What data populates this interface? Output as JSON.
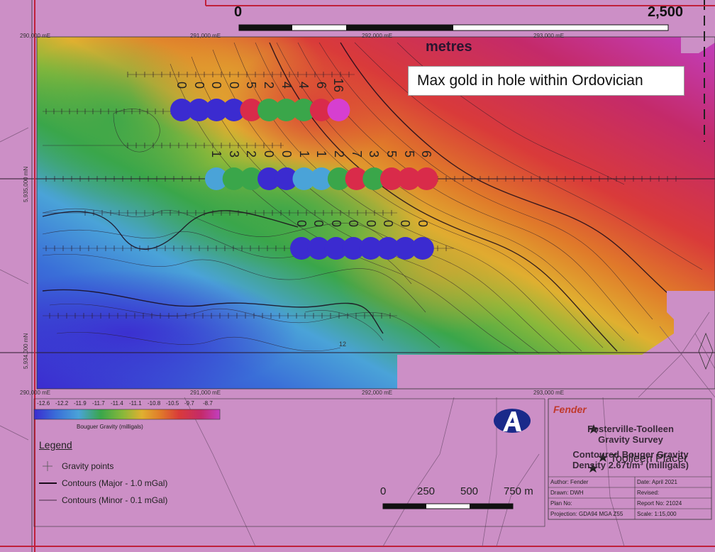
{
  "scale_top": {
    "start": "0",
    "end": "2,500",
    "unit": "metres"
  },
  "callout": "Max gold in hole within Ordovician",
  "coords": {
    "east_top": [
      "290,000 mE",
      "291,000 mE",
      "292,000 mE",
      "293,000 mE"
    ],
    "east_bottom": [
      "290,000 mE",
      "291,000 mE",
      "292,000 mE",
      "293,000 mE"
    ],
    "north": [
      "5,935,000 mN",
      "5,934,000 mN"
    ]
  },
  "contour_label": "12",
  "holes": {
    "row1": [
      {
        "label": "0",
        "color": "#3b2bd0"
      },
      {
        "label": "0",
        "color": "#3b2bd0"
      },
      {
        "label": "0",
        "color": "#3b2bd0"
      },
      {
        "label": "0",
        "color": "#3b2bd0"
      },
      {
        "label": "5",
        "color": "#d92b4a"
      },
      {
        "label": "2",
        "color": "#3aa64a"
      },
      {
        "label": "4",
        "color": "#3aa64a"
      },
      {
        "label": "4",
        "color": "#3aa64a"
      },
      {
        "label": "6",
        "color": "#d92b4a"
      },
      {
        "label": "16",
        "color": "#d63fd0"
      }
    ],
    "row2": [
      {
        "label": "1",
        "color": "#4aa3d8"
      },
      {
        "label": "3",
        "color": "#3aa64a"
      },
      {
        "label": "2",
        "color": "#3aa64a"
      },
      {
        "label": "0",
        "color": "#3b2bd0"
      },
      {
        "label": "0",
        "color": "#3b2bd0"
      },
      {
        "label": "1",
        "color": "#4aa3d8"
      },
      {
        "label": "1",
        "color": "#4aa3d8"
      },
      {
        "label": "2",
        "color": "#3aa64a"
      },
      {
        "label": "7",
        "color": "#d92b4a"
      },
      {
        "label": "3",
        "color": "#3aa64a"
      },
      {
        "label": "5",
        "color": "#d92b4a"
      },
      {
        "label": "5",
        "color": "#d92b4a"
      },
      {
        "label": "6",
        "color": "#d92b4a"
      }
    ],
    "row3": [
      {
        "label": "0",
        "color": "#3b2bd0"
      },
      {
        "label": "0",
        "color": "#3b2bd0"
      },
      {
        "label": "0",
        "color": "#3b2bd0"
      },
      {
        "label": "0",
        "color": "#3b2bd0"
      },
      {
        "label": "0",
        "color": "#3b2bd0"
      },
      {
        "label": "0",
        "color": "#3b2bd0"
      },
      {
        "label": "0",
        "color": "#3b2bd0"
      },
      {
        "label": "0",
        "color": "#3b2bd0"
      }
    ]
  },
  "gravity_scale": {
    "ticks": [
      "-12.6",
      "-12.2",
      "-11.9",
      "-11.7",
      "-11.4",
      "-11.1",
      "-10.8",
      "-10.5",
      "-9.7",
      "-8.7"
    ],
    "title": "Bouguer Gravity (milligals)",
    "colors": [
      "#3b2bd0",
      "#3a6fd8",
      "#4aa3d8",
      "#3aa64a",
      "#8ab83a",
      "#e0b030",
      "#e07a2a",
      "#d93a3a",
      "#c42a6a",
      "#c23fc0"
    ]
  },
  "legend": {
    "title": "Legend",
    "items": [
      "Gravity points",
      "Contours (Major - 1.0 mGal)",
      "Contours (Minor - 0.1 mGal)"
    ]
  },
  "scale_bottom": {
    "labels": [
      "0",
      "250",
      "500",
      "750 m"
    ]
  },
  "title_block": {
    "company": "Fender",
    "title_lines": [
      "Fosterville-Toolleen",
      "Gravity Survey",
      "Contoured Bouger Gravity",
      "Density 2.67t/m³ (milligals)"
    ],
    "place_label": "Toolleen Placer",
    "cells": [
      [
        "Author: Fender",
        "Date: April 2021"
      ],
      [
        "Drawn: DWH",
        "Revised:"
      ],
      [
        "Plan No:",
        "Report No: 21024"
      ],
      [
        "Projection: GDA94 MGA Z55",
        "Scale: 1:15,000"
      ]
    ]
  }
}
